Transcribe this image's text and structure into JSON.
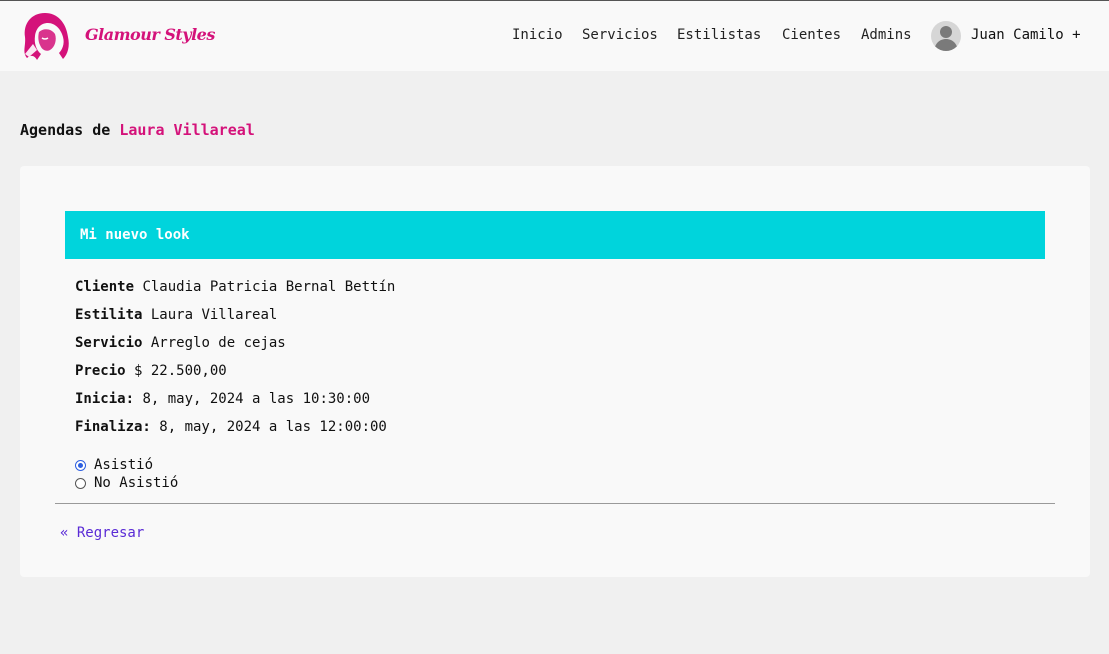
{
  "colors": {
    "brand": "#d4127a",
    "accent": "#00d4dc",
    "link": "#5a2bd6",
    "radio": "#2d5fe0"
  },
  "header": {
    "brand": "Glamour Styles",
    "logo_icon": "woman-hair-logo-icon",
    "nav": [
      "Inicio",
      "Servicios",
      "Estilistas",
      "Cientes",
      "Admins"
    ],
    "user": {
      "avatar_icon": "user-avatar-icon",
      "label": "Juan Camilo +"
    }
  },
  "page": {
    "heading_prefix": "Agendas de",
    "heading_name": "Laura Villareal"
  },
  "appointment": {
    "title": "Mi nuevo look",
    "fields": [
      {
        "label": "Cliente",
        "value": " Claudia Patricia Bernal Bettín"
      },
      {
        "label": "Estilita",
        "value": " Laura Villareal"
      },
      {
        "label": "Servicio",
        "value": " Arreglo de cejas"
      },
      {
        "label": "Precio",
        "value": " $ 22.500,00"
      },
      {
        "label": "Inicia:",
        "value": " 8, may, 2024 a las 10:30:00"
      },
      {
        "label": "Finaliza:",
        "value": " 8, may, 2024 a las 12:00:00"
      }
    ],
    "attendance": {
      "options": [
        "Asistió",
        "No Asistió"
      ],
      "selected": "Asistió"
    }
  },
  "back_link": "« Regresar"
}
